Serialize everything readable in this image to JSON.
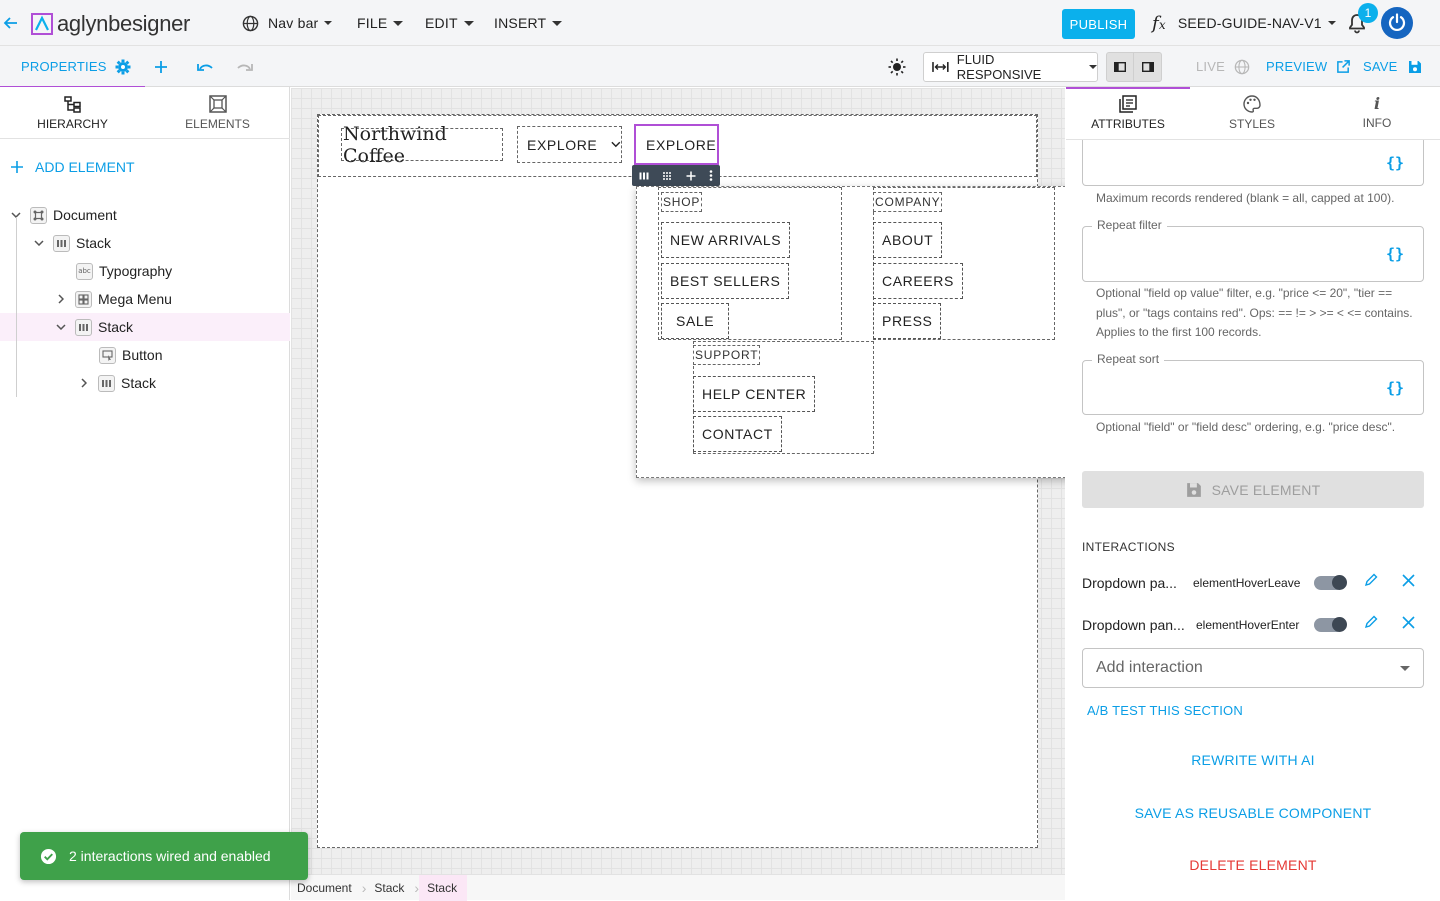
{
  "app": {
    "logo_text": "aglynbesigner",
    "site_selector": "Nav bar",
    "menus": [
      "FILE",
      "EDIT",
      "INSERT"
    ],
    "publish_label": "PUBLISH",
    "fx_label": "SEED-GUIDE-NAV-V1",
    "notification_count": "1"
  },
  "toolbar": {
    "properties_label": "PROPERTIES",
    "responsive_label": "FLUID RESPONSIVE",
    "live_label": "LIVE",
    "preview_label": "PREVIEW",
    "save_label": "SAVE"
  },
  "left": {
    "tabs": [
      {
        "label": "HIERARCHY"
      },
      {
        "label": "ELEMENTS"
      }
    ],
    "add_element": "ADD ELEMENT",
    "tree": [
      {
        "label": "Document"
      },
      {
        "label": "Stack"
      },
      {
        "label": "Typography"
      },
      {
        "label": "Mega Menu"
      },
      {
        "label": "Stack"
      },
      {
        "label": "Button"
      },
      {
        "label": "Stack"
      }
    ]
  },
  "canvas": {
    "brand": "Northwind Coffee",
    "explore_1": "EXPLORE",
    "explore_2": "EXPLORE",
    "shop_heading": "SHOP",
    "shop_items": [
      "NEW ARRIVALS",
      "BEST SELLERS",
      "SALE"
    ],
    "company_heading": "COMPANY",
    "company_items": [
      "ABOUT",
      "CAREERS",
      "PRESS"
    ],
    "support_heading": "SUPPORT",
    "support_items": [
      "HELP CENTER",
      "CONTACT"
    ]
  },
  "breadcrumb": [
    "Document",
    "Stack",
    "Stack"
  ],
  "right": {
    "tabs": [
      {
        "label": "ATTRIBUTES"
      },
      {
        "label": "STYLES"
      },
      {
        "label": "INFO"
      }
    ],
    "braces": "{}",
    "max_records_help": "Maximum records rendered (blank = all, capped at 100).",
    "repeat_filter_label": "Repeat filter",
    "repeat_filter_help": "Optional \"field op value\" filter, e.g. \"price <= 20\", \"tier == plus\", or \"tags contains red\". Ops: == != > >= < <= contains. Applies to the first 100 records.",
    "repeat_sort_label": "Repeat sort",
    "repeat_sort_help": "Optional \"field\" or \"field desc\" ordering, e.g. \"price desc\".",
    "save_element": "SAVE ELEMENT",
    "interactions_heading": "INTERACTIONS",
    "interactions": [
      {
        "name": "Dropdown pa...",
        "event": "elementHoverLeave",
        "enabled": true
      },
      {
        "name": "Dropdown pan...",
        "event": "elementHoverEnter",
        "enabled": true
      }
    ],
    "add_interaction_placeholder": "Add interaction",
    "ab_test": "A/B TEST THIS SECTION",
    "rewrite_ai": "REWRITE WITH AI",
    "save_component": "SAVE AS REUSABLE COMPONENT",
    "delete_element": "DELETE ELEMENT"
  },
  "toast": {
    "message": "2 interactions wired and enabled"
  },
  "colors": {
    "accent": "#0bb0ec",
    "link": "#0b9ee6",
    "selection": "#b04fd6",
    "danger": "#e53935",
    "toast": "#3fa14a"
  }
}
